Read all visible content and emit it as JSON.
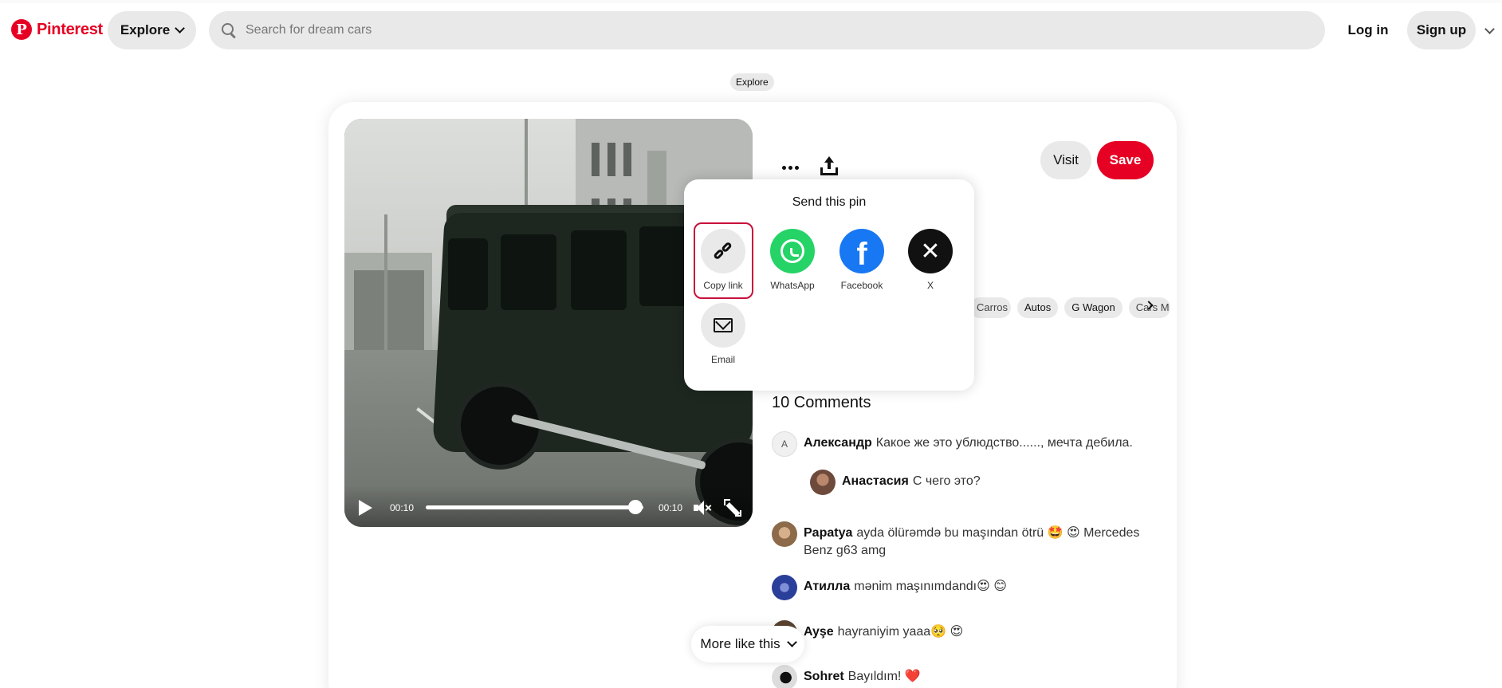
{
  "header": {
    "brand": "Pinterest",
    "explore_label": "Explore",
    "search_placeholder": "Search for dream cars",
    "login_label": "Log in",
    "signup_label": "Sign up"
  },
  "breadcrumb": "Explore",
  "video": {
    "time_elapsed": "00:10",
    "time_total": "00:10",
    "progress": 1.0
  },
  "actions": {
    "visit_label": "Visit",
    "save_label": "Save"
  },
  "share_popover": {
    "title": "Send this pin",
    "options": [
      {
        "label": "Copy link",
        "icon": "link-icon"
      },
      {
        "label": "WhatsApp",
        "icon": "whatsapp-icon"
      },
      {
        "label": "Facebook",
        "icon": "facebook-icon"
      },
      {
        "label": "X",
        "icon": "x-icon"
      },
      {
        "label": "Email",
        "icon": "email-icon"
      }
    ]
  },
  "tags": [
    "Carros",
    "Autos",
    "G Wagon",
    "Cars M"
  ],
  "comments": {
    "title": "10 Comments",
    "items": [
      {
        "name": "Александр",
        "text": "Какое же это ублюдство......, мечта дебила.",
        "avatar": "A"
      },
      {
        "name": "Анастасия",
        "text": "С чего это?",
        "avatar": ""
      },
      {
        "name": "Papatya",
        "text": "ayda ölürəmdə bu maşından ötrü 🤩 😍 Mercedes Benz g63 amg",
        "avatar": ""
      },
      {
        "name": "Атилла",
        "text": "mənim maşınımdandı😍 😊",
        "avatar": ""
      },
      {
        "name": "Ayşe",
        "text": "hayraniyim yaaa🥺 😍",
        "avatar": ""
      },
      {
        "name": "Sohret",
        "text": "Bayıldım! ❤️",
        "avatar": ""
      }
    ]
  },
  "more_like_label": "More like this",
  "colors": {
    "brand_red": "#e60023",
    "whatsapp": "#25d366",
    "facebook": "#1877f2",
    "focus_ring": "#c8103b"
  }
}
